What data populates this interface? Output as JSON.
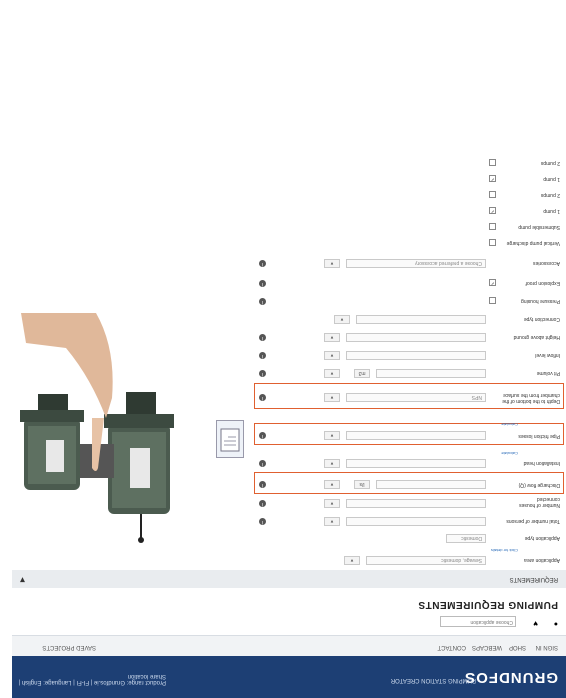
{
  "brand": {
    "name": "GRUNDFOS",
    "tagline": "PUMPING STATION CREATOR",
    "right_text": "Product range: Grundfos.ie | FI-FI | Language: English | Share location"
  },
  "subnav": [
    "SIGN IN",
    "SHOP",
    "WEBCAPS",
    "CONTACT",
    "ACCESSORIES",
    "SAVED PROJECTS"
  ],
  "search": {
    "placeholder": "Choose application"
  },
  "page_title": "PUMPING REQUIREMENTS",
  "section": {
    "label": "REQUIREMENTS"
  },
  "fields": [
    {
      "label": "Application area",
      "value": "Sewage, domestic",
      "link": "Click for details"
    },
    {
      "label": "Application type",
      "value": "Domestic"
    },
    {
      "label": "Total number of persons",
      "value": ""
    },
    {
      "label": "Number of houses connected",
      "value": ""
    },
    {
      "label": "Discharge flow (Q)",
      "value": "",
      "unit": "l/s"
    },
    {
      "label": "Installation head",
      "value": "",
      "link": "Calculate"
    },
    {
      "label": "Pipe friction losses",
      "value": "",
      "link": "Calculate"
    },
    {
      "label": "Depth to the bottom of the chamber from the surface",
      "value": "NPS"
    },
    {
      "label": "Pit volume",
      "value": "",
      "unit": "m3"
    },
    {
      "label": "Inflow level",
      "value": ""
    },
    {
      "label": "Height above ground",
      "value": ""
    },
    {
      "label": "Connection type",
      "value": ""
    }
  ],
  "checks": [
    {
      "label": "Pressure housing",
      "checked": false
    },
    {
      "label": "Explosion proof",
      "checked": true
    },
    {
      "label": "Accessories",
      "value": "Choose a preferred accessory"
    },
    {
      "label": "Vertical pump discharge",
      "checked": false
    },
    {
      "label": "Submersible pump",
      "checked": false
    },
    {
      "label": "1 pump",
      "checked": true
    },
    {
      "label": "2 pumps",
      "checked": false
    },
    {
      "label": "1 pump",
      "checked": true
    },
    {
      "label": "2 pumps",
      "checked": false
    }
  ],
  "icons": {
    "info": "info-icon",
    "chevron": "chevron-down-icon",
    "heart": "heart-icon",
    "user": "user-icon"
  }
}
